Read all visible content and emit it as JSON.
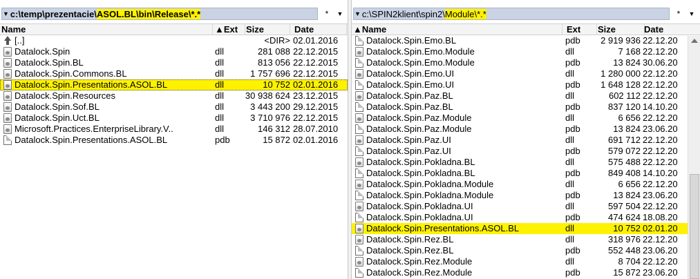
{
  "left": {
    "path_parts": [
      "c:\\temp\\prezentacie\\",
      "ASOL.BL\\bin\\Release\\*.*"
    ],
    "star": "*",
    "dropdown": "▾",
    "headers": {
      "name": "Name",
      "ext": "▲Ext",
      "size": "Size",
      "date": "Date"
    },
    "rows": [
      {
        "icon": "up",
        "name": "[..]",
        "ext": "",
        "size": "<DIR>",
        "date": "02.01.2016"
      },
      {
        "icon": "dll",
        "name": "Datalock.Spin",
        "ext": "dll",
        "size": "281 088",
        "date": "22.12.2015"
      },
      {
        "icon": "dll",
        "name": "Datalock.Spin.BL",
        "ext": "dll",
        "size": "813 056",
        "date": "22.12.2015"
      },
      {
        "icon": "dll",
        "name": "Datalock.Spin.Commons.BL",
        "ext": "dll",
        "size": "1 757 696",
        "date": "22.12.2015"
      },
      {
        "icon": "dll",
        "name": "Datalock.Spin.Presentations.ASOL.BL",
        "ext": "dll",
        "size": "10 752",
        "date": "02.01.2016"
      },
      {
        "icon": "dll",
        "name": "Datalock.Spin.Resources",
        "ext": "dll",
        "size": "30 938 624",
        "date": "23.12.2015"
      },
      {
        "icon": "dll",
        "name": "Datalock.Spin.Sof.BL",
        "ext": "dll",
        "size": "3 443 200",
        "date": "29.12.2015"
      },
      {
        "icon": "dll",
        "name": "Datalock.Spin.Uct.BL",
        "ext": "dll",
        "size": "3 710 976",
        "date": "22.12.2015"
      },
      {
        "icon": "dll",
        "name": "Microsoft.Practices.EnterpriseLibrary.V..",
        "ext": "dll",
        "size": "146 312",
        "date": "28.07.2010"
      },
      {
        "icon": "pdb",
        "name": "Datalock.Spin.Presentations.ASOL.BL",
        "ext": "pdb",
        "size": "15 872",
        "date": "02.01.2016"
      }
    ]
  },
  "right": {
    "path_parts": [
      "c:\\SPIN2klient\\spin2\\",
      "Module\\*.*"
    ],
    "star": "*",
    "dropdown": "▾",
    "headers": {
      "name": "▲Name",
      "ext": "Ext",
      "size": "Size",
      "date": "Date"
    },
    "rows": [
      {
        "icon": "pdb",
        "name": "Datalock.Spin.Emo.BL",
        "ext": "pdb",
        "size": "2 919 936",
        "date": "22.12.20"
      },
      {
        "icon": "dll",
        "name": "Datalock.Spin.Emo.Module",
        "ext": "dll",
        "size": "7 168",
        "date": "22.12.20"
      },
      {
        "icon": "pdb",
        "name": "Datalock.Spin.Emo.Module",
        "ext": "pdb",
        "size": "13 824",
        "date": "30.06.20"
      },
      {
        "icon": "dll",
        "name": "Datalock.Spin.Emo.UI",
        "ext": "dll",
        "size": "1 280 000",
        "date": "22.12.20"
      },
      {
        "icon": "pdb",
        "name": "Datalock.Spin.Emo.UI",
        "ext": "pdb",
        "size": "1 648 128",
        "date": "22.12.20"
      },
      {
        "icon": "dll",
        "name": "Datalock.Spin.Paz.BL",
        "ext": "dll",
        "size": "602 112",
        "date": "22.12.20"
      },
      {
        "icon": "pdb",
        "name": "Datalock.Spin.Paz.BL",
        "ext": "pdb",
        "size": "837 120",
        "date": "14.10.20"
      },
      {
        "icon": "dll",
        "name": "Datalock.Spin.Paz.Module",
        "ext": "dll",
        "size": "6 656",
        "date": "22.12.20"
      },
      {
        "icon": "pdb",
        "name": "Datalock.Spin.Paz.Module",
        "ext": "pdb",
        "size": "13 824",
        "date": "23.06.20"
      },
      {
        "icon": "dll",
        "name": "Datalock.Spin.Paz.UI",
        "ext": "dll",
        "size": "691 712",
        "date": "22.12.20"
      },
      {
        "icon": "pdb",
        "name": "Datalock.Spin.Paz.UI",
        "ext": "pdb",
        "size": "579 072",
        "date": "22.12.20"
      },
      {
        "icon": "dll",
        "name": "Datalock.Spin.Pokladna.BL",
        "ext": "dll",
        "size": "575 488",
        "date": "22.12.20"
      },
      {
        "icon": "pdb",
        "name": "Datalock.Spin.Pokladna.BL",
        "ext": "pdb",
        "size": "849 408",
        "date": "14.10.20"
      },
      {
        "icon": "dll",
        "name": "Datalock.Spin.Pokladna.Module",
        "ext": "dll",
        "size": "6 656",
        "date": "22.12.20"
      },
      {
        "icon": "pdb",
        "name": "Datalock.Spin.Pokladna.Module",
        "ext": "pdb",
        "size": "13 824",
        "date": "23.06.20"
      },
      {
        "icon": "dll",
        "name": "Datalock.Spin.Pokladna.UI",
        "ext": "dll",
        "size": "597 504",
        "date": "22.12.20"
      },
      {
        "icon": "pdb",
        "name": "Datalock.Spin.Pokladna.UI",
        "ext": "pdb",
        "size": "474 624",
        "date": "18.08.20"
      },
      {
        "icon": "dll",
        "name": "Datalock.Spin.Presentations.ASOL.BL",
        "ext": "dll",
        "size": "10 752",
        "date": "02.01.20"
      },
      {
        "icon": "dll",
        "name": "Datalock.Spin.Rez.BL",
        "ext": "dll",
        "size": "318 976",
        "date": "22.12.20"
      },
      {
        "icon": "pdb",
        "name": "Datalock.Spin.Rez.BL",
        "ext": "pdb",
        "size": "552 448",
        "date": "23.06.20"
      },
      {
        "icon": "dll",
        "name": "Datalock.Spin.Rez.Module",
        "ext": "dll",
        "size": "8 704",
        "date": "22.12.20"
      },
      {
        "icon": "pdb",
        "name": "Datalock.Spin.Rez.Module",
        "ext": "pdb",
        "size": "15 872",
        "date": "23.06.20"
      }
    ]
  }
}
